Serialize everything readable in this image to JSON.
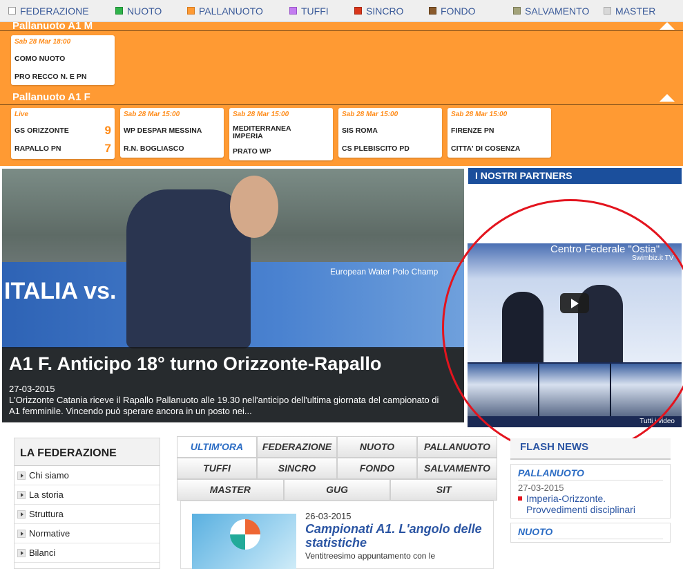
{
  "filters": [
    {
      "label": "FEDERAZIONE",
      "color": "#ffffff"
    },
    {
      "label": "NUOTO",
      "color": "#2fb34a"
    },
    {
      "label": "PALLANUOTO",
      "color": "#ff9a33"
    },
    {
      "label": "TUFFI",
      "color": "#c37cf0"
    },
    {
      "label": "SINCRO",
      "color": "#d9361b"
    },
    {
      "label": "FONDO",
      "color": "#8a5a2b"
    },
    {
      "label": "SALVAMENTO",
      "color": "#a3a37a"
    },
    {
      "label": "MASTER",
      "color": "#d8d8d8"
    }
  ],
  "leagues": {
    "a1m": {
      "title": "Pallanuoto A1 M",
      "matches": [
        {
          "when": "Sab 28 Mar 18:00",
          "home": "COMO NUOTO",
          "away": "PRO RECCO N. E PN",
          "home_score": "",
          "away_score": ""
        }
      ]
    },
    "a1f": {
      "title": "Pallanuoto A1 F",
      "matches": [
        {
          "when": "Live",
          "home": "GS ORIZZONTE",
          "away": "RAPALLO PN",
          "home_score": "9",
          "away_score": "7"
        },
        {
          "when": "Sab 28 Mar 15:00",
          "home": "WP DESPAR MESSINA",
          "away": "R.N. BOGLIASCO",
          "home_score": "",
          "away_score": ""
        },
        {
          "when": "Sab 28 Mar 15:00",
          "home": "MEDITERRANEA IMPERIA",
          "away": "PRATO WP",
          "home_score": "",
          "away_score": ""
        },
        {
          "when": "Sab 28 Mar 15:00",
          "home": "SIS ROMA",
          "away": "CS PLEBISCITO PD",
          "home_score": "",
          "away_score": ""
        },
        {
          "when": "Sab 28 Mar 15:00",
          "home": "FIRENZE PN",
          "away": "CITTA' DI COSENZA",
          "home_score": "",
          "away_score": ""
        }
      ]
    }
  },
  "hero": {
    "title": "A1 F. Anticipo 18° turno Orizzonte-Rapallo",
    "date": "27-03-2015",
    "description": "L'Orizzonte Catania riceve il Rapallo Pallanuoto alle 19.30 nell'anticipo dell'ultima giornata del campionato di A1 femminile. Vincendo può sperare ancora in un posto nei...",
    "banner_text": "ITALIA vs.",
    "sponsor_text": "European Water Polo Champ"
  },
  "partners": {
    "title": "I NOSTRI PARTNERS",
    "video_link": "Tutti i video",
    "video_caption": "Centro Federale \"Ostia\"",
    "video_channel": "Swimbiz.it TV"
  },
  "federazione": {
    "title": "LA FEDERAZIONE",
    "items": [
      "Chi siamo",
      "La storia",
      "Struttura",
      "Normative",
      "Bilanci"
    ]
  },
  "tabs": {
    "row1": [
      "ULTIM'ORA",
      "FEDERAZIONE",
      "NUOTO",
      "PALLANUOTO"
    ],
    "row2": [
      "TUFFI",
      "SINCRO",
      "FONDO",
      "SALVAMENTO"
    ],
    "row3": [
      "MASTER",
      "GUG",
      "SIT"
    ]
  },
  "news": {
    "date": "26-03-2015",
    "headline": "Campionati A1. L'angolo delle statistiche",
    "excerpt": "Ventitreesimo appuntamento con le"
  },
  "flash": {
    "title": "FLASH NEWS",
    "blocks": [
      {
        "category": "PALLANUOTO",
        "date": "27-03-2015",
        "text": "Imperia-Orizzonte. Provvedimenti disciplinari"
      },
      {
        "category": "NUOTO",
        "date": "",
        "text": ""
      }
    ]
  },
  "colors": {
    "accent_orange": "#ff9a33",
    "brand_blue": "#1b4f9c",
    "highlight_red": "#e3141e"
  }
}
